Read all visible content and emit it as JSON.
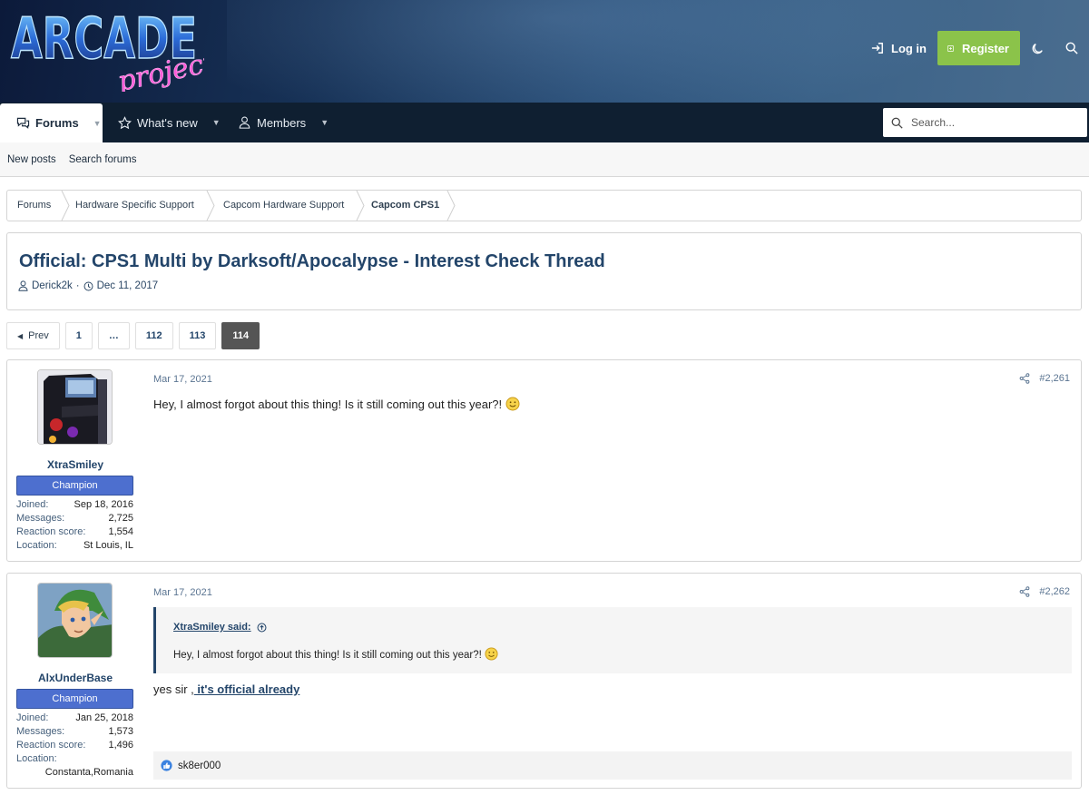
{
  "header": {
    "logo_text": "ARCADE",
    "logo_script": "project",
    "login_label": "Log in",
    "register_label": "Register"
  },
  "nav": {
    "tabs": [
      {
        "label": "Forums",
        "active": true
      },
      {
        "label": "What's new",
        "active": false
      },
      {
        "label": "Members",
        "active": false
      }
    ],
    "search_placeholder": "Search..."
  },
  "subnav": {
    "items": [
      "New posts",
      "Search forums"
    ]
  },
  "breadcrumb": [
    "Forums",
    "Hardware Specific Support",
    "Capcom Hardware Support",
    "Capcom CPS1"
  ],
  "thread": {
    "title": "Official: CPS1 Multi by Darksoft/Apocalypse - Interest Check Thread",
    "author": "Derick2k",
    "separator": "·",
    "date": "Dec 11, 2017"
  },
  "pagination": {
    "prev_label": "Prev",
    "pages": [
      "1",
      "…",
      "112",
      "113",
      "114"
    ],
    "current": "114"
  },
  "posts": [
    {
      "username": "XtraSmiley",
      "rank": "Champion",
      "stats": [
        {
          "k": "Joined:",
          "v": "Sep 18, 2016"
        },
        {
          "k": "Messages:",
          "v": "2,725"
        },
        {
          "k": "Reaction score:",
          "v": "1,554"
        },
        {
          "k": "Location:",
          "v": "St Louis, IL"
        }
      ],
      "date": "Mar 17, 2021",
      "number": "#2,261",
      "body": "Hey, I almost forgot about this thing! Is it still coming out this year?!"
    },
    {
      "username": "AlxUnderBase",
      "rank": "Champion",
      "stats": [
        {
          "k": "Joined:",
          "v": "Jan 25, 2018"
        },
        {
          "k": "Messages:",
          "v": "1,573"
        },
        {
          "k": "Reaction score:",
          "v": "1,496"
        },
        {
          "k": "Location:",
          "v": ""
        }
      ],
      "location_value": "Constanta,Romania",
      "date": "Mar 17, 2021",
      "number": "#2,262",
      "quote": {
        "author": "XtraSmiley said:",
        "text": "Hey, I almost forgot about this thing! Is it still coming out this year?!"
      },
      "body_prefix": "yes sir ,",
      "body_link": " it's official already",
      "reaction_user": "sk8er000"
    }
  ],
  "colors": {
    "accent": "#23456a",
    "register": "#8bc34a",
    "badge": "#4d6fcf",
    "navbar": "#0f1f31"
  }
}
